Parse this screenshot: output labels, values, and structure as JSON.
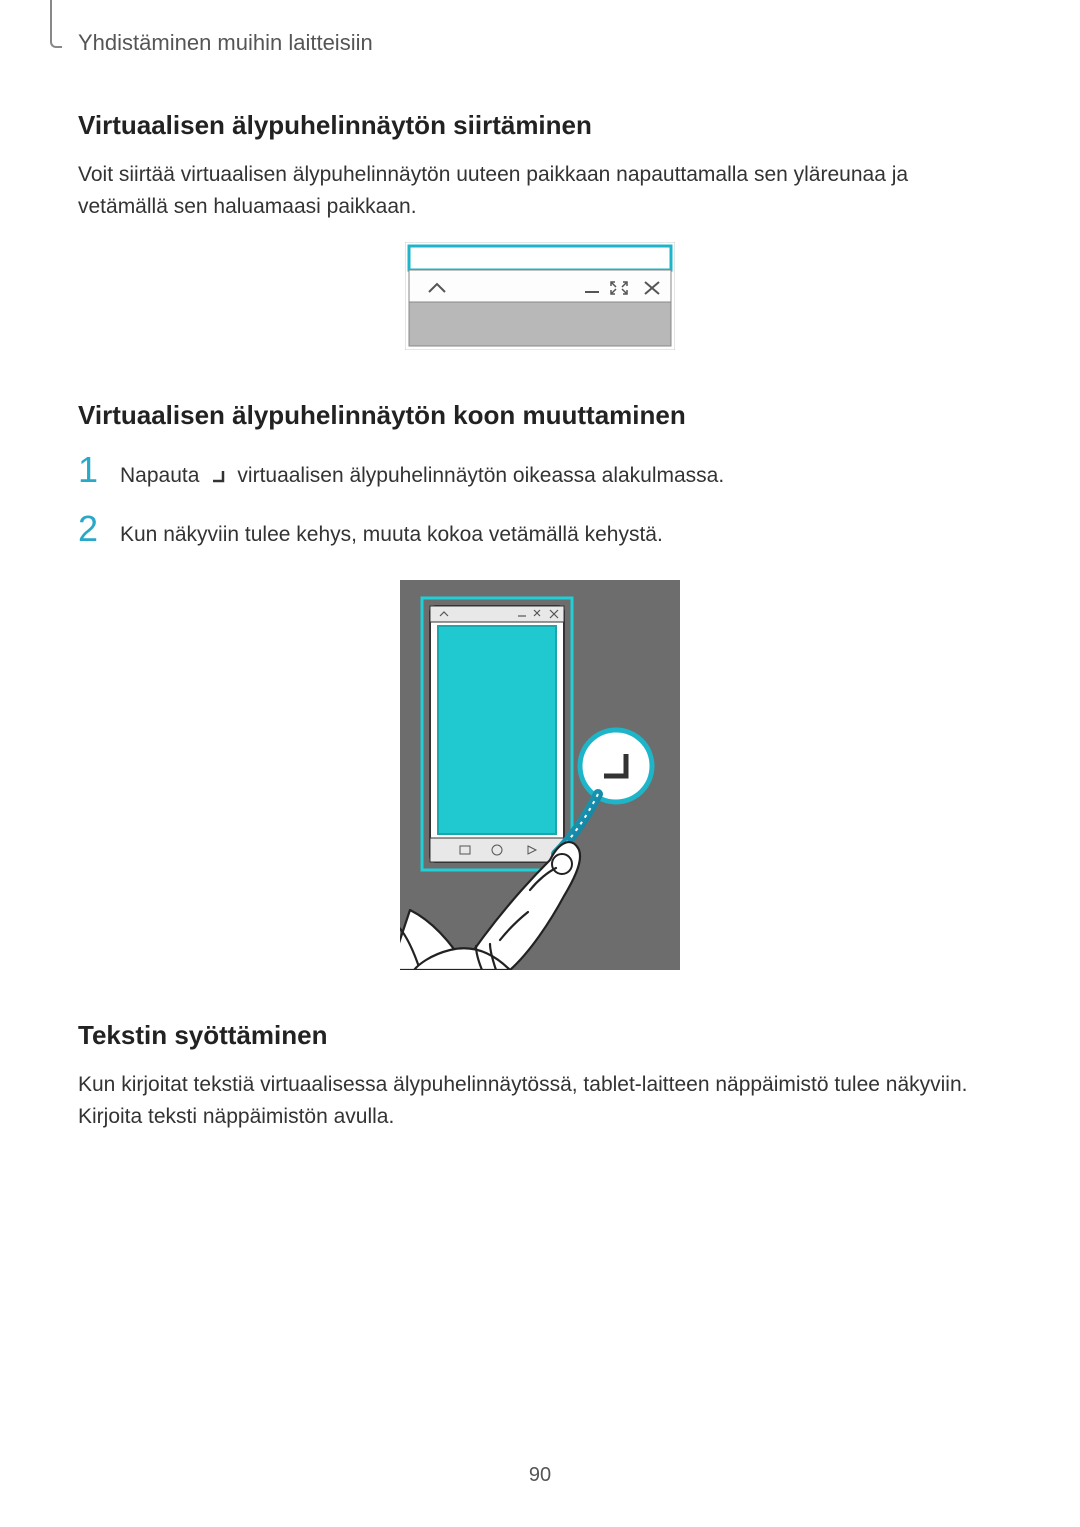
{
  "header": {
    "section_title": "Yhdistäminen muihin laitteisiin"
  },
  "section1": {
    "heading": "Virtuaalisen älypuhelinnäytön siirtäminen",
    "body": "Voit siirtää virtuaalisen älypuhelinnäytön uuteen paikkaan napauttamalla sen yläreunaa ja vetämällä sen haluamaasi paikkaan."
  },
  "section2": {
    "heading": "Virtuaalisen älypuhelinnäytön koon muuttaminen",
    "step1_num": "1",
    "step1_pre": "Napauta",
    "step1_post": "virtuaalisen älypuhelinnäytön oikeassa alakulmassa.",
    "step2_num": "2",
    "step2_text": "Kun näkyviin tulee kehys, muuta kokoa vetämällä kehystä."
  },
  "section3": {
    "heading": "Tekstin syöttäminen",
    "body": "Kun kirjoitat tekstiä virtuaalisessa älypuhelinnäytössä, tablet-laitteen näppäimistö tulee näkyviin. Kirjoita teksti näppäimistön avulla."
  },
  "page_number": "90",
  "icons": {
    "chevron_up": "chevron-up-icon",
    "minimize": "minimize-icon",
    "fullscreen": "fullscreen-icon",
    "close": "close-icon",
    "resize_corner": "resize-corner-icon"
  }
}
